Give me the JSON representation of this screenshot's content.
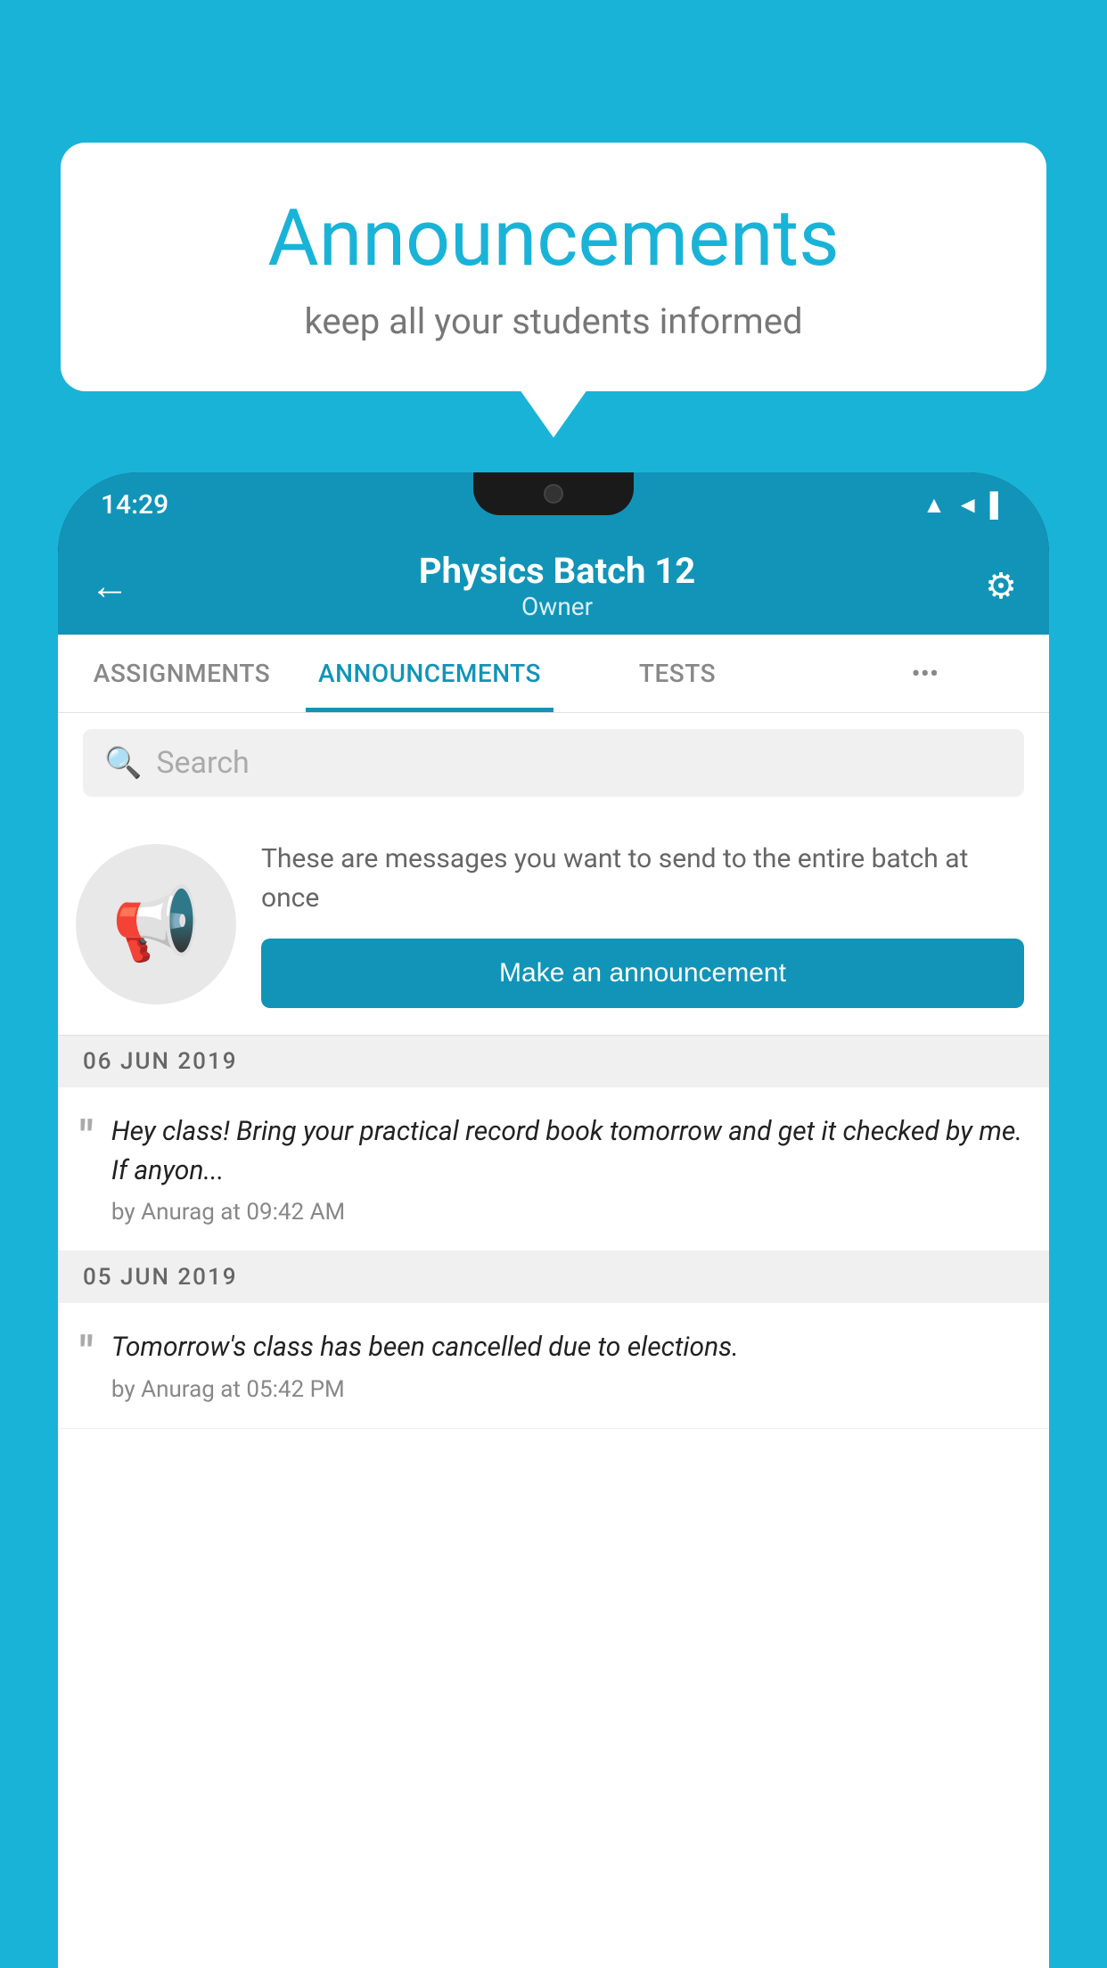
{
  "bubble": {
    "title": "Announcements",
    "subtitle": "keep all your students informed"
  },
  "statusBar": {
    "time": "14:29",
    "icons": [
      "▲",
      "◄",
      "▌"
    ]
  },
  "appBar": {
    "title": "Physics Batch 12",
    "subtitle": "Owner",
    "backLabel": "←",
    "settingsLabel": "⚙"
  },
  "tabs": [
    {
      "label": "ASSIGNMENTS",
      "active": false
    },
    {
      "label": "ANNOUNCEMENTS",
      "active": true
    },
    {
      "label": "TESTS",
      "active": false
    },
    {
      "label": "•••",
      "active": false
    }
  ],
  "search": {
    "placeholder": "Search"
  },
  "announcementPlaceholder": {
    "description": "These are messages you want to send to the entire batch at once",
    "buttonLabel": "Make an announcement"
  },
  "announcements": [
    {
      "date": "06  JUN  2019",
      "message": "Hey class! Bring your practical record book tomorrow and get it checked by me. If anyon...",
      "meta": "by Anurag at 09:42 AM"
    },
    {
      "date": "05  JUN  2019",
      "message": "Tomorrow's class has been cancelled due to elections.",
      "meta": "by Anurag at 05:42 PM"
    }
  ]
}
